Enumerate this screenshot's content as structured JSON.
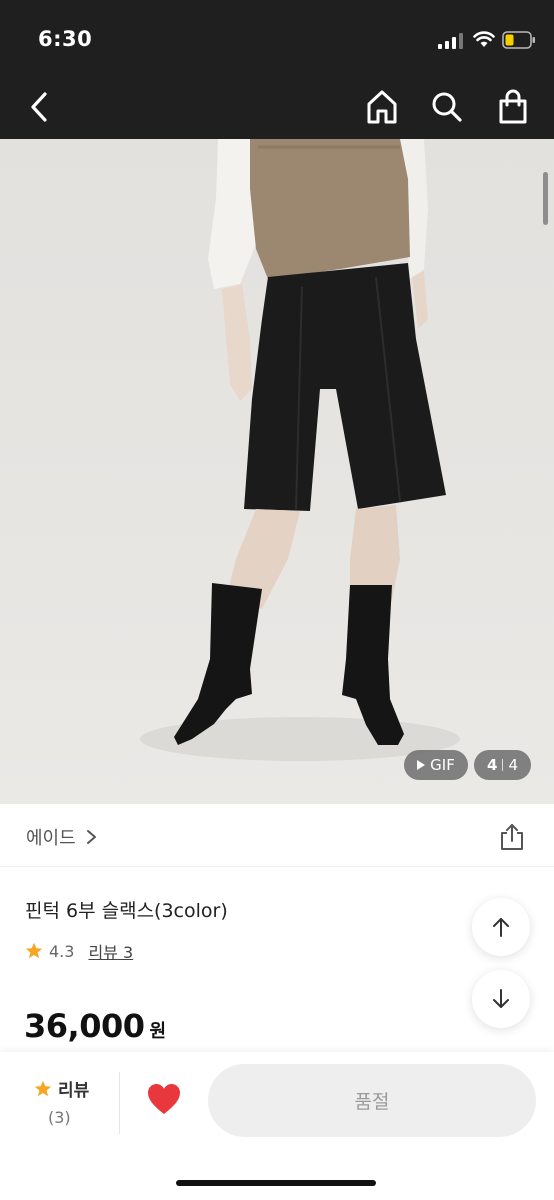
{
  "status_bar": {
    "time": "6:30"
  },
  "nav": {
    "icons": [
      "back-icon",
      "home-icon",
      "search-icon",
      "shopping-bag-icon"
    ]
  },
  "product": {
    "gif_label": "GIF",
    "image_index": "4",
    "image_total": "4",
    "brand": "에이드",
    "title": "핀턱 6부 슬랙스(3color)",
    "rating": "4.3",
    "review_link": "리뷰 3",
    "price": "36,000",
    "price_unit": "원"
  },
  "bottom_bar": {
    "review_label": "리뷰",
    "review_count": "(3)",
    "soldout_label": "품절"
  },
  "colors": {
    "header_bg": "#1f1f1f",
    "star": "#f5a623",
    "heart": "#e8383d",
    "soldout_bg": "#eeeeee",
    "battery": "#f5d000"
  }
}
